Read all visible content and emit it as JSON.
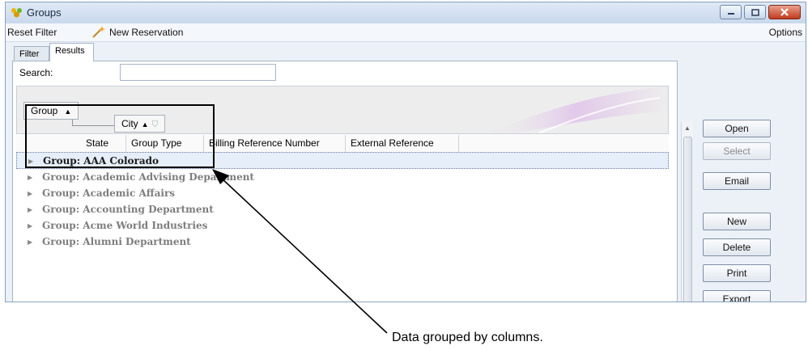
{
  "window": {
    "title": "Groups"
  },
  "menu": {
    "reset_filter": "Reset Filter",
    "new_reservation": "New Reservation",
    "options": "Options"
  },
  "tabs": [
    {
      "label": "Filter"
    },
    {
      "label": "Results"
    }
  ],
  "search": {
    "label": "Search:",
    "value": ""
  },
  "group_by": [
    {
      "label": "Group",
      "sort": "ascending"
    },
    {
      "label": "City",
      "sort": "ascending",
      "filter": true
    }
  ],
  "columns": [
    "State",
    "Group Type",
    "Billing Reference Number",
    "External Reference"
  ],
  "rows": [
    {
      "label": "Group: AAA Colorado",
      "selected": true
    },
    {
      "label": "Group: Academic Advising Department",
      "selected": false
    },
    {
      "label": "Group: Academic Affairs",
      "selected": false
    },
    {
      "label": "Group: Accounting Department",
      "selected": false
    },
    {
      "label": "Group: Acme World Industries",
      "selected": false
    },
    {
      "label": "Group: Alumni Department",
      "selected": false
    }
  ],
  "buttons": {
    "open": "Open",
    "select": "Select",
    "email": "Email",
    "new": "New",
    "delete": "Delete",
    "print": "Print",
    "export": "Export"
  },
  "callout": {
    "text": "Data grouped by columns."
  }
}
